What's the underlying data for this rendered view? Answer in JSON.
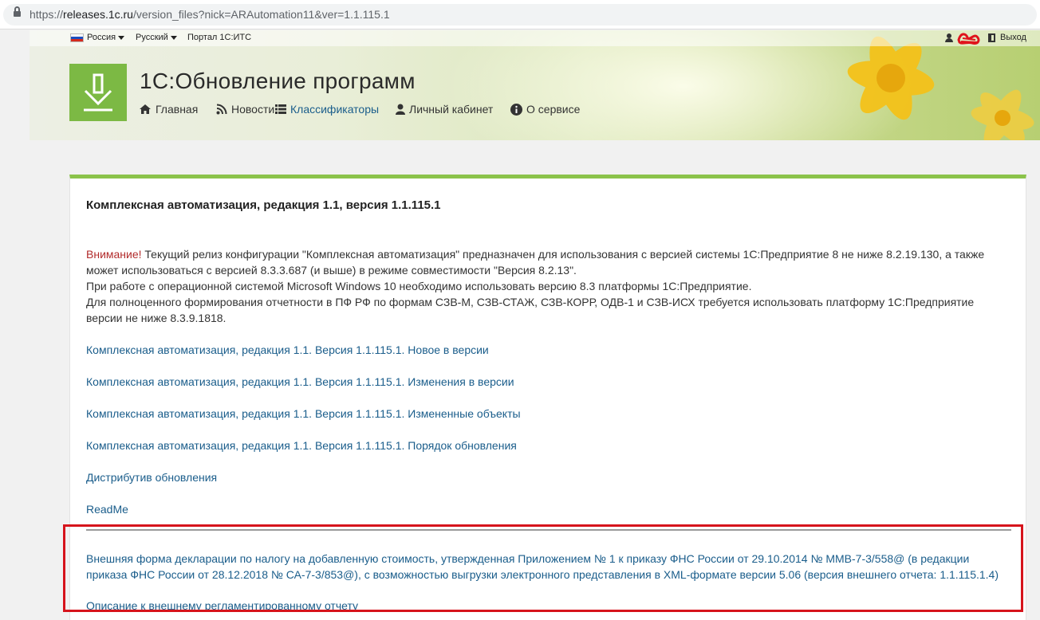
{
  "browser": {
    "url_scheme": "https://",
    "url_host": "releases.1c.ru",
    "url_path": "/version_files?nick=ARAutomation11&ver=1.1.115.1"
  },
  "topbar": {
    "region": "Россия",
    "language": "Русский",
    "portal": "Портал 1С:ИТС",
    "logout": "Выход"
  },
  "header": {
    "title": "1С:Обновление программ",
    "nav": [
      {
        "label": "Главная",
        "icon": "home-icon"
      },
      {
        "label": "Новости",
        "icon": "rss-icon"
      },
      {
        "label": "Классификаторы",
        "icon": "list-icon"
      },
      {
        "label": "Личный кабинет",
        "icon": "user-icon"
      },
      {
        "label": "О сервисе",
        "icon": "info-icon"
      }
    ]
  },
  "content": {
    "title": "Комплексная автоматизация, редакция 1.1, версия 1.1.115.1",
    "warning_label": "Внимание!",
    "notice_line1": " Текущий релиз конфигурации \"Комплексная автоматизация\" предназначен для использования с версией системы 1С:Предприятие 8 не ниже 8.2.19.130, а также может использоваться с версией 8.3.3.687 (и выше) в режиме совместимости \"Версия 8.2.13\".",
    "notice_line2": "При работе с операционной системой Microsoft Windows 10 необходимо использовать версию 8.3 платформы 1С:Предприятие.",
    "notice_line3": "Для полноценного формирования отчетности в ПФ РФ по формам СЗВ-М, СЗВ-СТАЖ, СЗВ-КОРР, ОДВ-1 и СЗВ-ИСХ требуется использовать платформу 1С:Предприятие версии не ниже 8.3.9.1818.",
    "links": [
      "Комплексная автоматизация, редакция 1.1. Версия 1.1.115.1. Новое в версии",
      "Комплексная автоматизация, редакция 1.1. Версия 1.1.115.1. Изменения в версии",
      "Комплексная автоматизация, редакция 1.1. Версия 1.1.115.1. Измененные объекты",
      "Комплексная автоматизация, редакция 1.1. Версия 1.1.115.1. Порядок обновления",
      "Дистрибутив обновления",
      "ReadMe"
    ],
    "external_form": "Внешняя форма декларации по налогу на добавленную стоимость, утвержденная Приложением № 1 к приказу ФНС России от 29.10.2014 № ММВ-7-3/558@ (в редакции приказа ФНС России от 28.12.2018 № СА-7-3/853@), с возможностью выгрузки электронного представления в XML-формате версии 5.06 (версия внешнего отчета: 1.1.115.1.4)",
    "external_description": "Описание к внешнему регламентированному отчету"
  },
  "colors": {
    "link": "#1a5d8b",
    "accent_green": "#8bc34a",
    "warning_red": "#b22c2c",
    "annotation_red": "#d6141c"
  }
}
